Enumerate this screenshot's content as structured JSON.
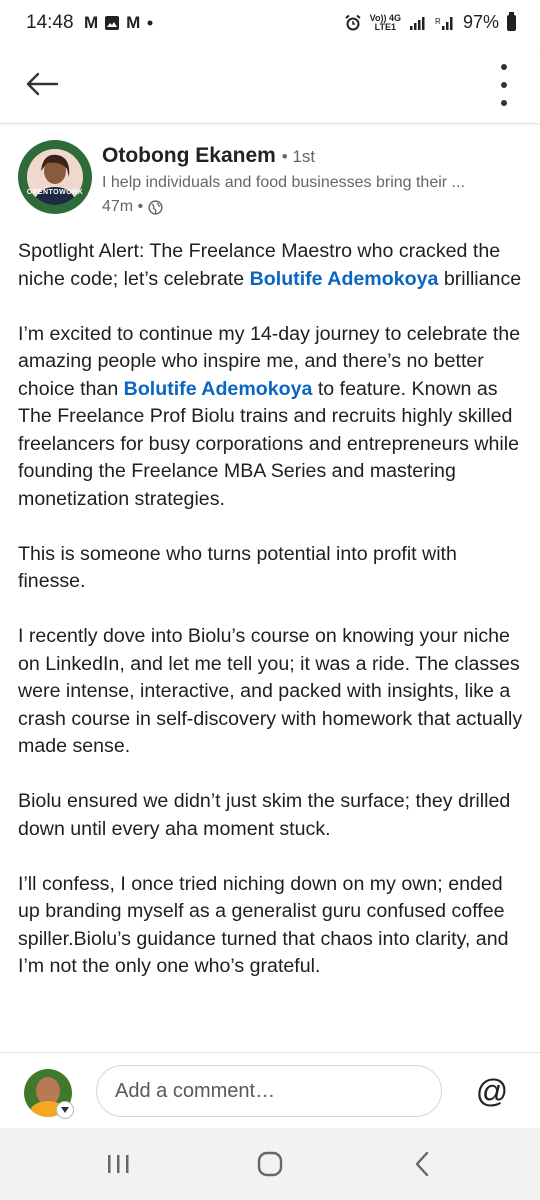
{
  "status_bar": {
    "time": "14:48",
    "notifications": [
      "M",
      "M"
    ],
    "network_top": "Vo)) 4G",
    "network_bottom": "LTE1",
    "battery": "97%"
  },
  "post": {
    "author": {
      "name": "Otobong Ekanem",
      "degree": "• 1st",
      "headline": "I help individuals and food businesses bring their ...",
      "time": "47m •",
      "avatar_ring_text": "OPENTOWORK"
    },
    "paragraphs": [
      [
        {
          "text": "Spotlight Alert: The Freelance Maestro who cracked the niche code; let’s celebrate "
        },
        {
          "text": "Bolutife Ademokoya",
          "mention": true
        },
        {
          "text": " brilliance"
        }
      ],
      [
        {
          "text": "I’m excited to continue my 14-day journey to celebrate the amazing people who inspire me, and there’s no better choice than "
        },
        {
          "text": "Bolutife Ademokoya",
          "mention": true
        },
        {
          "text": "  to feature. Known as The Freelance Prof Biolu trains and recruits highly skilled freelancers for busy corporations and entrepreneurs while founding the Freelance MBA Series and mastering monetization strategies."
        }
      ],
      [
        {
          "text": "This is someone who turns potential into profit with finesse."
        }
      ],
      [
        {
          "text": "I recently dove into Biolu’s course on knowing your niche on LinkedIn, and let me tell you; it was a ride. The classes were intense, interactive, and packed with insights, like a crash course in self-discovery with homework that actually made sense."
        }
      ],
      [
        {
          "text": "Biolu ensured we didn’t just skim the surface; they drilled down until every aha moment stuck."
        }
      ],
      [
        {
          "text": "I’ll confess, I once tried niching down on my own; ended up branding myself as a generalist guru confused coffee spiller.Biolu’s guidance turned that chaos into clarity, and I’m not the only one who’s grateful."
        }
      ]
    ]
  },
  "comment": {
    "placeholder": "Add a comment…",
    "mention_symbol": "@"
  },
  "colors": {
    "mention": "#0a66c2",
    "ring": "#2e6b3a"
  }
}
